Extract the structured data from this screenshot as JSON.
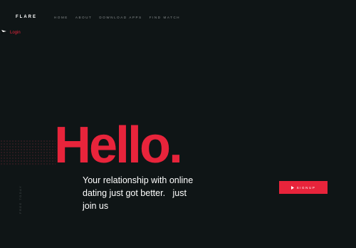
{
  "brand": "FLARE",
  "nav": {
    "items": [
      {
        "label": "HOME"
      },
      {
        "label": "ABOUT"
      },
      {
        "label": "DOWNLOAD APPS"
      },
      {
        "label": "FIND MATCH"
      }
    ]
  },
  "login": {
    "label": "Login",
    "icon": "login-arrow-icon"
  },
  "hero": {
    "heading": "Hello.",
    "tagline": "Your relationship with online dating just got better.   just join us",
    "vertical_text": "FREE TODAY"
  },
  "signup": {
    "label": "SIGNUP",
    "icon": "play-icon"
  },
  "colors": {
    "accent": "#e8243b",
    "background": "#0f1516",
    "text": "#ffffff",
    "nav_text": "#8a8f90"
  }
}
